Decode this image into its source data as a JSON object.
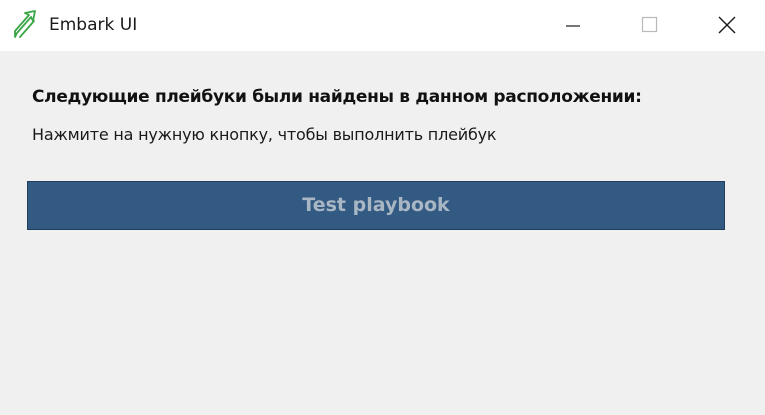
{
  "window": {
    "title": "Embark UI"
  },
  "main": {
    "heading": "Следующие плейбуки были найдены в данном расположении:",
    "subtitle": "Нажмите на нужную кнопку, чтобы выполнить плейбук",
    "playbooks": [
      {
        "label": "Test playbook"
      }
    ]
  },
  "colors": {
    "titlebar_bg": "#ffffff",
    "window_bg": "#f0f0f0",
    "button_bg": "#325a83",
    "button_text": "#a9b6c4",
    "icon_accent": "#3aa645"
  },
  "icons": {
    "app": "embark-logo-icon",
    "minimize": "minimize-icon",
    "maximize": "maximize-icon",
    "close": "close-icon"
  }
}
